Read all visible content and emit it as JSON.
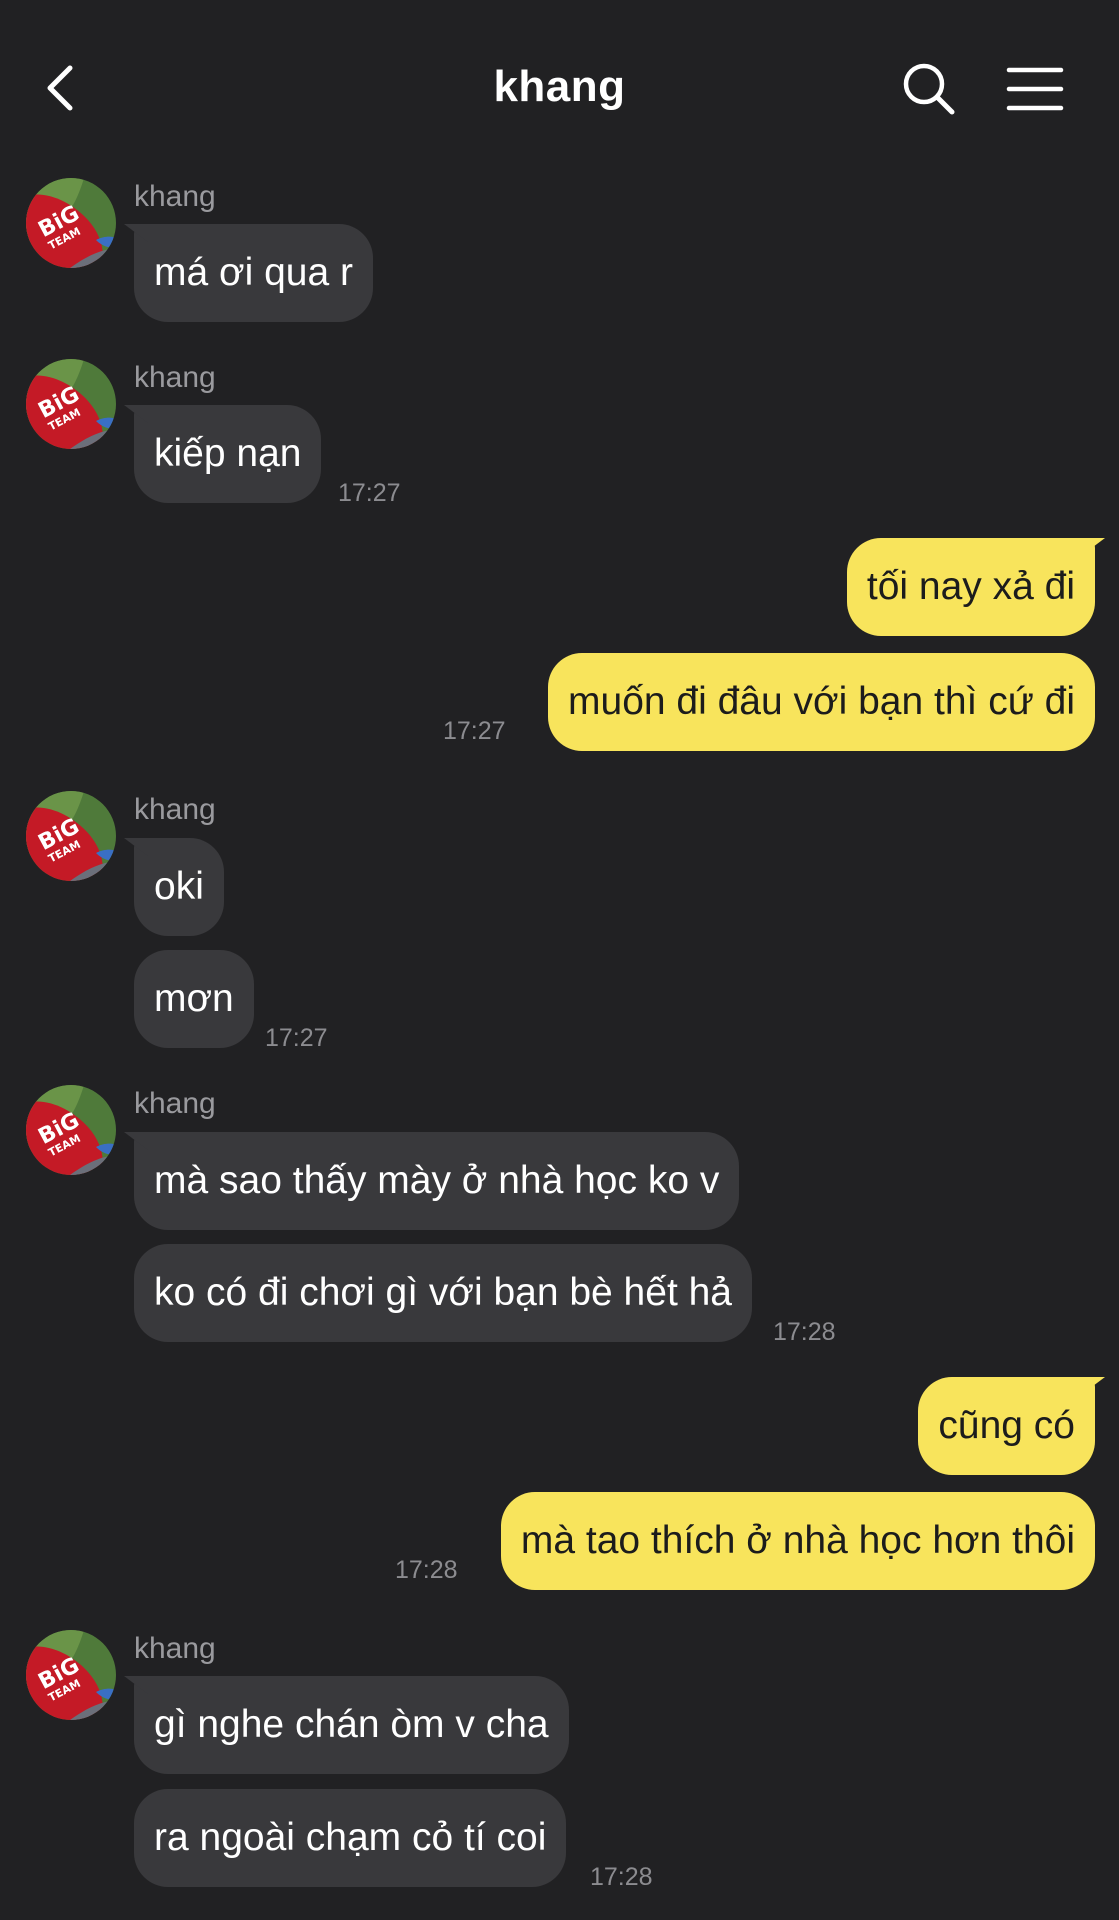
{
  "header": {
    "title": "khang",
    "back_icon": "chevron-left-icon",
    "search_icon": "search-icon",
    "menu_icon": "hamburger-menu-icon"
  },
  "contact": {
    "name": "khang"
  },
  "messages": [
    {
      "from": "khang",
      "text": "má ơi qua r"
    },
    {
      "from": "khang",
      "text": "kiếp nạn",
      "time": "17:27"
    },
    {
      "from": "me",
      "text": "tối nay xả đi"
    },
    {
      "from": "me",
      "text": "muốn đi đâu với bạn thì cứ đi",
      "time": "17:27"
    },
    {
      "from": "khang",
      "text": "oki"
    },
    {
      "from": "khang",
      "text": "mơn",
      "time": "17:27"
    },
    {
      "from": "khang",
      "text": "mà sao thấy mày ở nhà học ko v"
    },
    {
      "from": "khang",
      "text": "ko có đi chơi gì với bạn bè hết hả",
      "time": "17:28"
    },
    {
      "from": "me",
      "text": "cũng có"
    },
    {
      "from": "me",
      "text": "mà tao thích ở nhà học hơn thôi",
      "time": "17:28"
    },
    {
      "from": "khang",
      "text": "gì nghe chán òm v cha"
    },
    {
      "from": "khang",
      "text": "ra ngoài chạm cỏ tí coi",
      "time": "17:28"
    }
  ],
  "colors": {
    "background": "#212123",
    "incoming_bubble": "#39393c",
    "outgoing_bubble": "#f8e45c",
    "timestamp": "#8c8c90"
  }
}
